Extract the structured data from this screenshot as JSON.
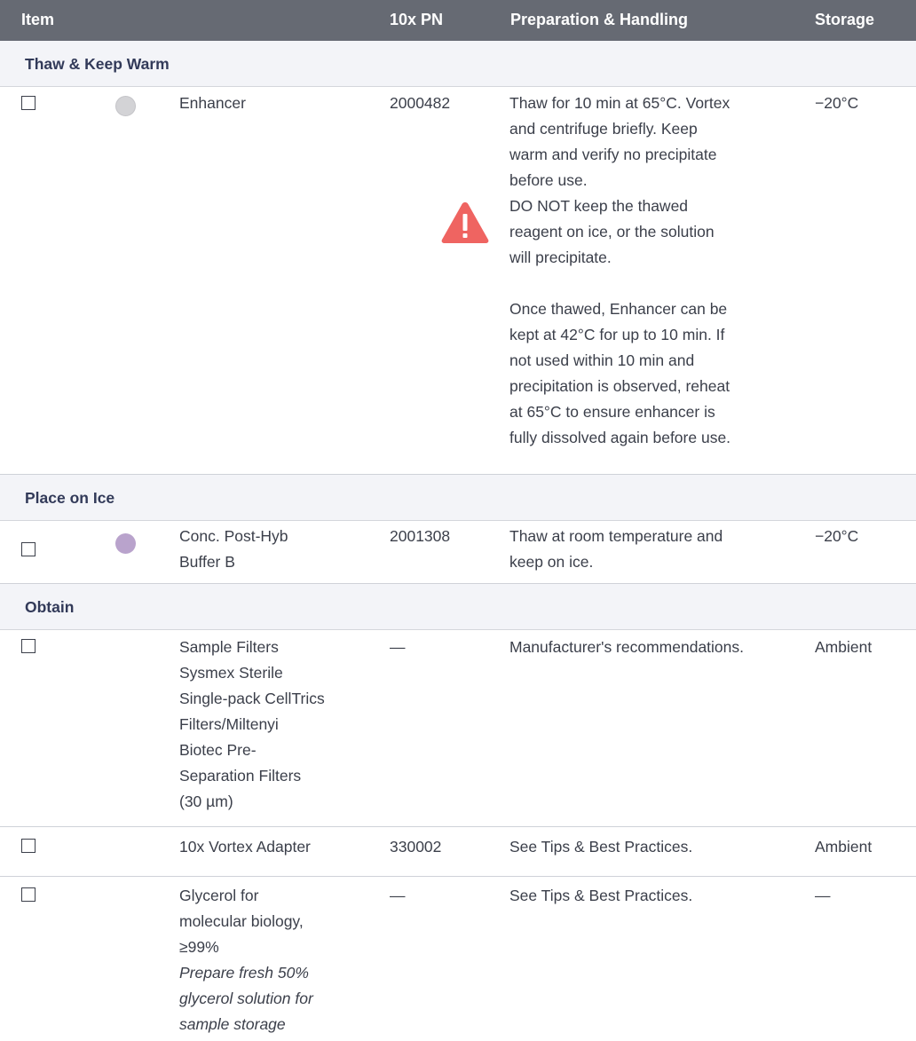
{
  "header": {
    "item": "Item",
    "pn": "10x PN",
    "prep": "Preparation & Handling",
    "storage": "Storage"
  },
  "sections": {
    "thaw": "Thaw & Keep Warm",
    "ice": "Place on Ice",
    "obtain": "Obtain"
  },
  "rows": {
    "enhancer": {
      "item": "Enhancer",
      "pn": "2000482",
      "prep_lines": [
        "Thaw for 10 min at 65°C. Vortex",
        "and centrifuge briefly. Keep",
        "warm and verify no precipitate",
        "before use."
      ],
      "warning_lines": [
        "DO NOT keep the thawed",
        "reagent on ice, or the solution",
        "will precipitate."
      ],
      "note_lines": [
        "Once thawed, Enhancer can be",
        "kept at 42°C for up to 10 min. If",
        "not used within 10 min and",
        "precipitation is observed, reheat",
        "at 65°C to ensure enhancer is",
        "fully dissolved again before use."
      ],
      "storage": "−20°C",
      "dot_color": "#d3d3d6"
    },
    "posthyb": {
      "item_lines": [
        "Conc. Post-Hyb",
        "Buffer B"
      ],
      "pn": "2001308",
      "prep_lines": [
        "Thaw at room temperature and",
        "keep on ice."
      ],
      "storage": "−20°C",
      "dot_color": "#b9a3cc"
    },
    "filters": {
      "item_lines": [
        "Sample Filters",
        "Sysmex Sterile",
        "Single-pack CellTrics",
        "Filters/Miltenyi",
        "Biotec Pre-",
        "Separation Filters",
        "(30 µm)"
      ],
      "pn": "—",
      "prep": "Manufacturer's recommendations.",
      "storage": "Ambient"
    },
    "vortex": {
      "item": "10x Vortex Adapter",
      "pn": "330002",
      "prep": "See Tips & Best Practices.",
      "storage": "Ambient"
    },
    "glycerol": {
      "item_lines": [
        "Glycerol for",
        "molecular biology,",
        "≥99%"
      ],
      "item_note_lines": [
        "Prepare fresh 50%",
        "glycerol solution for",
        "sample storage"
      ],
      "pn": "—",
      "prep": "See Tips & Best Practices.",
      "storage": "—"
    }
  },
  "icons": {
    "warning": "warning-triangle-icon",
    "warning_color": "#ef6461"
  }
}
